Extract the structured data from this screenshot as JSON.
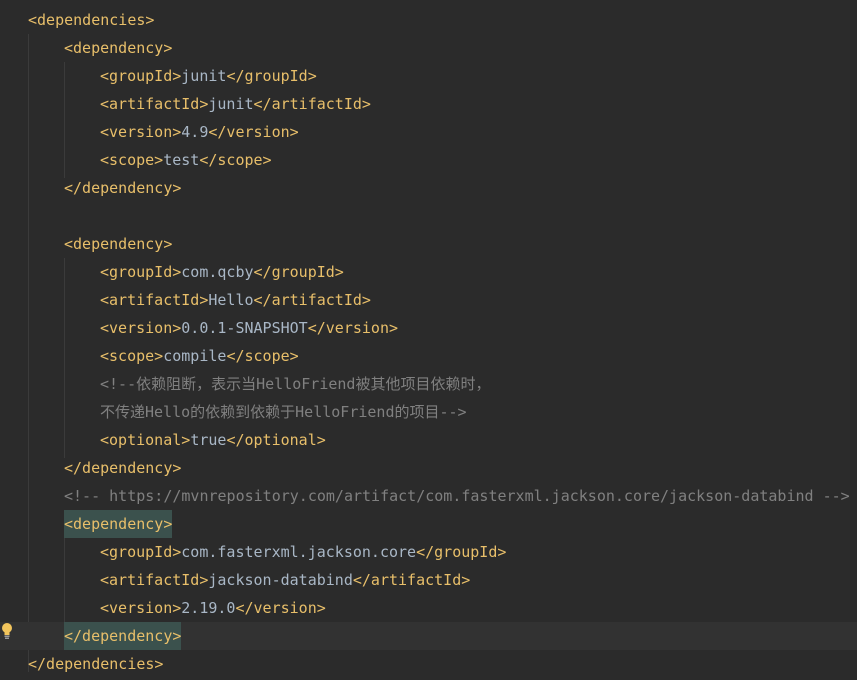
{
  "lines": [
    {
      "tag": "<dependencies>"
    },
    {
      "tag": "<dependency>"
    },
    {
      "open": "<groupId>",
      "text": "junit",
      "close": "</groupId>"
    },
    {
      "open": "<artifactId>",
      "text": "junit",
      "close": "</artifactId>"
    },
    {
      "open": "<version>",
      "text": "4.9",
      "close": "</version>"
    },
    {
      "open": "<scope>",
      "text": "test",
      "close": "</scope>"
    },
    {
      "tag": "</dependency>"
    },
    {},
    {
      "tag": "<dependency>"
    },
    {
      "open": "<groupId>",
      "text": "com.qcby",
      "close": "</groupId>"
    },
    {
      "open": "<artifactId>",
      "text": "Hello",
      "close": "</artifactId>"
    },
    {
      "open": "<version>",
      "text": "0.0.1-SNAPSHOT",
      "close": "</version>"
    },
    {
      "open": "<scope>",
      "text": "compile",
      "close": "</scope>"
    },
    {
      "comment": "<!--依赖阻断，表示当HelloFriend被其他项目依赖时，"
    },
    {
      "comment": "不传递Hello的依赖到依赖于HelloFriend的项目-->"
    },
    {
      "open": "<optional>",
      "text": "true",
      "close": "</optional>"
    },
    {
      "tag": "</dependency>"
    },
    {
      "comment": "<!-- https://mvnrepository.com/artifact/com.fasterxml.jackson.core/jackson-databind -->"
    },
    {
      "tag": "<dependency>"
    },
    {
      "open": "<groupId>",
      "text": "com.fasterxml.jackson.core",
      "close": "</groupId>"
    },
    {
      "open": "<artifactId>",
      "text": "jackson-databind",
      "close": "</artifactId>"
    },
    {
      "open": "<version>",
      "text": "2.19.0",
      "close": "</version>"
    },
    {
      "tag": "</dependency>"
    },
    {
      "tag": "</dependencies>"
    }
  ],
  "colors": {
    "background": "#2b2b2b",
    "tag": "#e8bf6a",
    "text": "#a9b7c6",
    "comment": "#808080",
    "current_line": "#323232",
    "bracket_match": "#3b514d"
  },
  "icons": {
    "gutter": "lightbulb-icon"
  }
}
